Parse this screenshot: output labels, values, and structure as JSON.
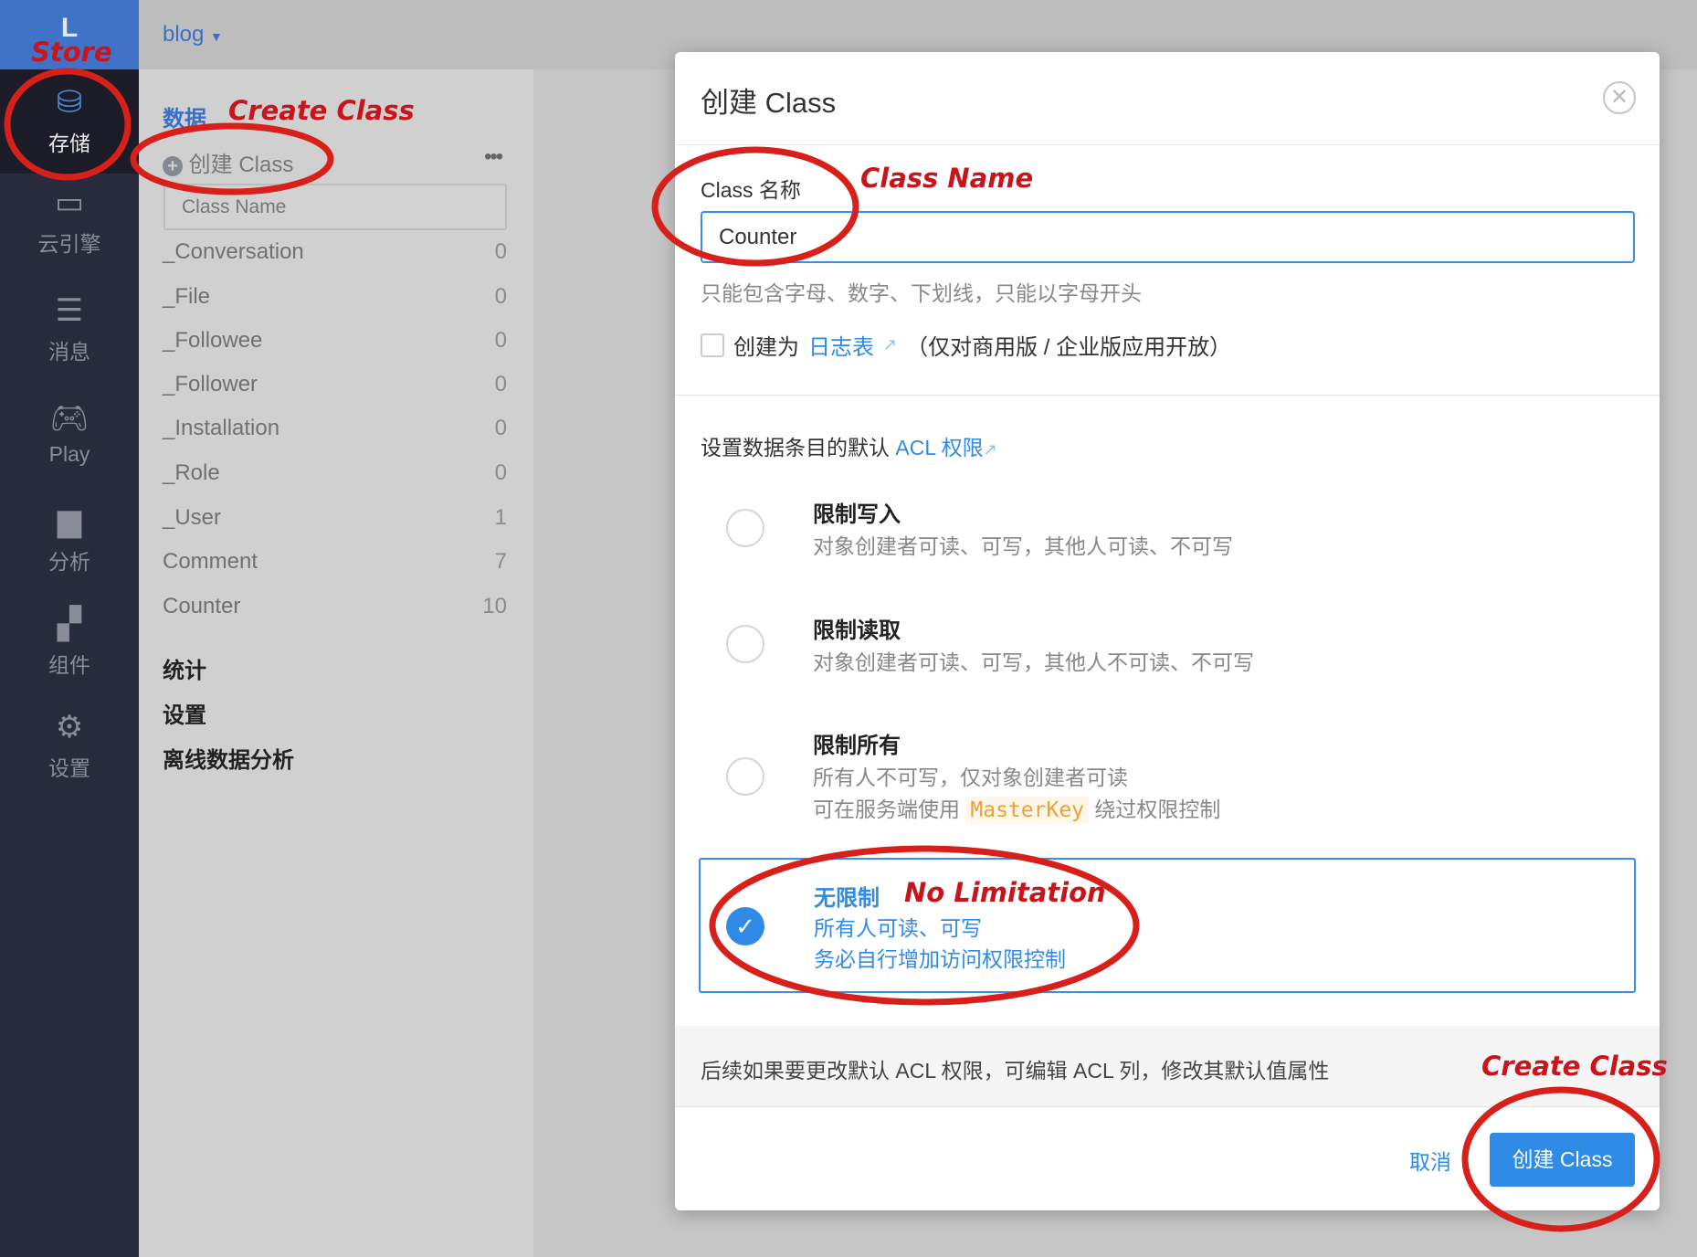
{
  "app": {
    "logo_letter": "L",
    "project": "blog"
  },
  "sidebar": {
    "items": [
      {
        "label": "存储",
        "icon": "database-icon",
        "active": true
      },
      {
        "label": "云引擎",
        "icon": "server-icon"
      },
      {
        "label": "消息",
        "icon": "message-icon"
      },
      {
        "label": "Play",
        "icon": "gamepad-icon"
      },
      {
        "label": "分析",
        "icon": "bar-chart-icon"
      },
      {
        "label": "组件",
        "icon": "components-icon"
      },
      {
        "label": "设置",
        "icon": "gear-icon"
      }
    ]
  },
  "panel": {
    "heading": "数据",
    "create_label": "创建 Class",
    "search_placeholder": "Class Name",
    "classes": [
      {
        "name": "_Conversation",
        "count": "0"
      },
      {
        "name": "_File",
        "count": "0"
      },
      {
        "name": "_Followee",
        "count": "0"
      },
      {
        "name": "_Follower",
        "count": "0"
      },
      {
        "name": "_Installation",
        "count": "0"
      },
      {
        "name": "_Role",
        "count": "0"
      },
      {
        "name": "_User",
        "count": "1"
      },
      {
        "name": "Comment",
        "count": "7"
      },
      {
        "name": "Counter",
        "count": "10"
      }
    ],
    "sections": [
      "统计",
      "设置",
      "离线数据分析"
    ]
  },
  "modal": {
    "title": "创建 Class",
    "name_label": "Class 名称",
    "name_value": "Counter",
    "name_hint": "只能包含字母、数字、下划线，只能以字母开头",
    "log_prefix": "创建为",
    "log_link": "日志表",
    "log_suffix": "（仅对商用版 / 企业版应用开放）",
    "acl_prefix": "设置数据条目的默认",
    "acl_link": "ACL 权限",
    "options": [
      {
        "title": "限制写入",
        "desc": "对象创建者可读、可写，其他人可读、不可写",
        "selected": false
      },
      {
        "title": "限制读取",
        "desc": "对象创建者可读、可写，其他人不可读、不可写",
        "selected": false
      },
      {
        "title": "限制所有",
        "desc": "所有人不可写，仅对象创建者可读",
        "desc2_prefix": "可在服务端使用",
        "desc2_code": "MasterKey",
        "desc2_suffix": "绕过权限控制",
        "selected": false
      },
      {
        "title": "无限制",
        "desc": "所有人可读、可写",
        "desc2": "务必自行增加访问权限控制",
        "selected": true
      }
    ],
    "footnote": "后续如果要更改默认 ACL 权限，可编辑 ACL 列，修改其默认值属性",
    "cancel": "取消",
    "submit": "创建 Class"
  },
  "annotations": {
    "store": "Store",
    "create_class_top": "Create Class",
    "class_name": "Class Name",
    "no_limitation": "No Limitation",
    "create_class_bottom": "Create Class"
  },
  "colors": {
    "accent": "#2f8be6",
    "annotation": "#d8201a",
    "code": "#f0a030"
  }
}
